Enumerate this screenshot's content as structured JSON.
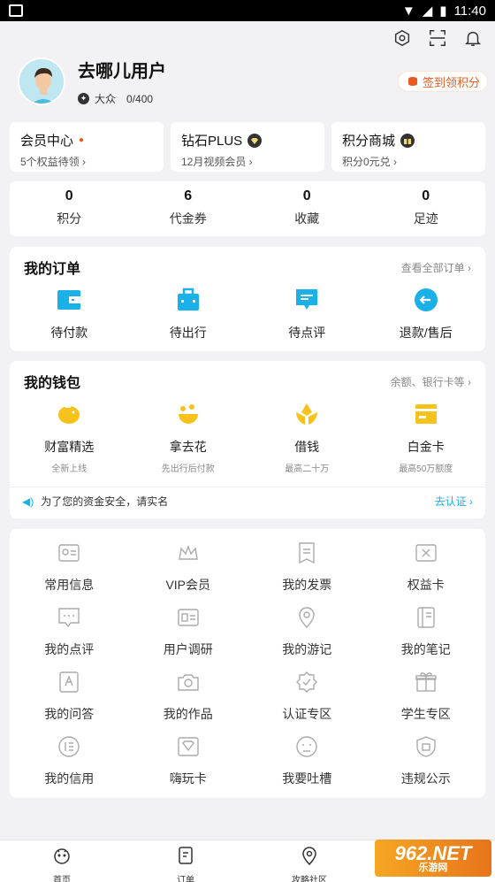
{
  "status": {
    "time": "11:40"
  },
  "profile": {
    "name": "去哪儿用户",
    "level": "大众",
    "points": "0/400"
  },
  "sign_button": "签到领积分",
  "cards": [
    {
      "title": "会员中心",
      "sub": "5个权益待领 ›"
    },
    {
      "title": "钻石PLUS",
      "sub": "12月视频会员 ›"
    },
    {
      "title": "积分商城",
      "sub": "积分0元兑 ›"
    }
  ],
  "stats": [
    {
      "num": "0",
      "label": "积分"
    },
    {
      "num": "6",
      "label": "代金券"
    },
    {
      "num": "0",
      "label": "收藏"
    },
    {
      "num": "0",
      "label": "足迹"
    }
  ],
  "orders": {
    "title": "我的订单",
    "link": "查看全部订单 ›",
    "items": [
      "待付款",
      "待出行",
      "待点评",
      "退款/售后"
    ]
  },
  "wallet": {
    "title": "我的钱包",
    "link": "余额、银行卡等 ›",
    "items": [
      {
        "label": "财富精选",
        "sub": "全新上线"
      },
      {
        "label": "拿去花",
        "sub": "先出行后付款"
      },
      {
        "label": "借钱",
        "sub": "最高二十万"
      },
      {
        "label": "白金卡",
        "sub": "最高50万额度"
      }
    ],
    "notice": "为了您的资金安全，请实名",
    "notice_link": "去认证 ›"
  },
  "services": [
    "常用信息",
    "VIP会员",
    "我的发票",
    "权益卡",
    "我的点评",
    "用户调研",
    "我的游记",
    "我的笔记",
    "我的问答",
    "我的作品",
    "认证专区",
    "学生专区",
    "我的信用",
    "嗨玩卡",
    "我要吐槽",
    "违规公示"
  ],
  "tabs": [
    "首页",
    "订单",
    "攻略社区"
  ],
  "watermark": {
    "main": "962.NET",
    "sub": "乐游网"
  },
  "colors": {
    "accent": "#1ab0e8",
    "wallet": "#f7c21a",
    "orange": "#e85b1e"
  }
}
